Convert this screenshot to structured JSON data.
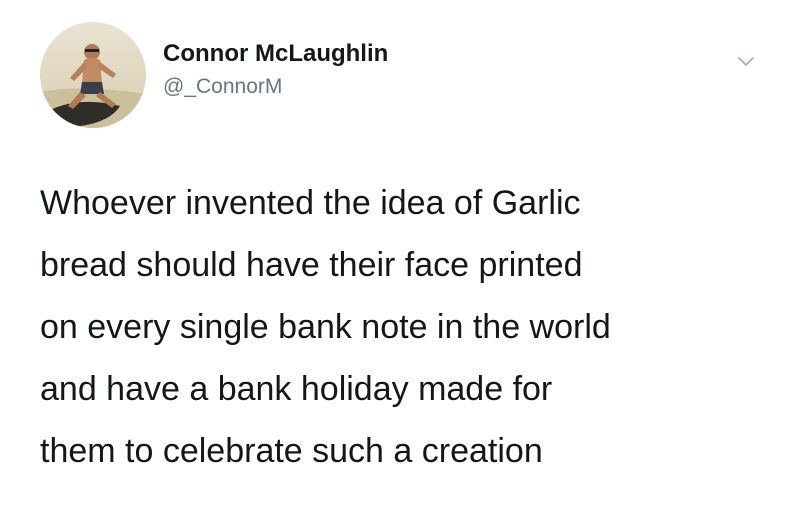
{
  "user": {
    "display_name": "Connor McLaughlin",
    "handle": "@_ConnorM"
  },
  "icons": {
    "avatar": "profile-photo",
    "menu": "chevron-down-icon"
  },
  "tweet": {
    "lines": [
      "Whoever invented the idea of Garlic",
      "bread should have their face printed",
      "on every single bank note in the world",
      "and have a bank holiday made for",
      "them to celebrate such a creation"
    ]
  },
  "colors": {
    "text": "#14171a",
    "secondary_text": "#657786",
    "background": "#ffffff"
  }
}
